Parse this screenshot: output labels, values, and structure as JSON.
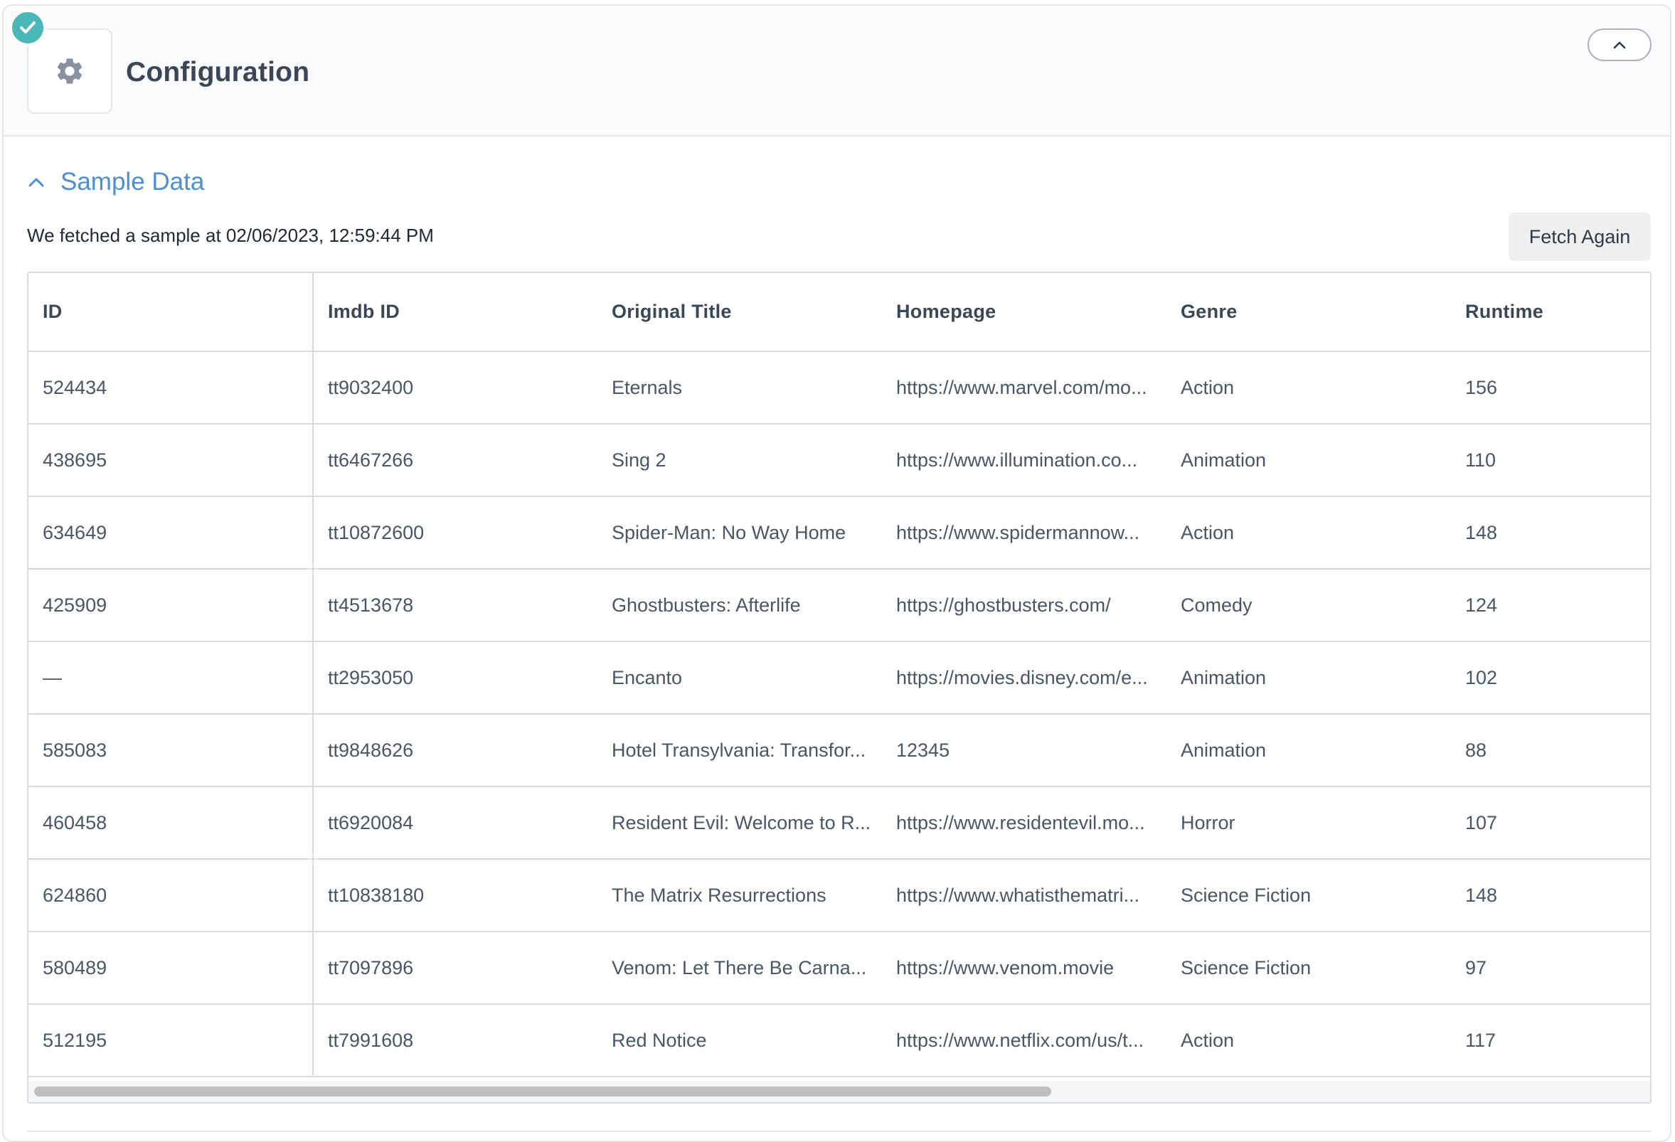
{
  "header": {
    "title": "Configuration",
    "status_icon": "check-circle-icon",
    "settings_icon": "gear-icon",
    "collapse_icon": "chevron-up-icon"
  },
  "sample_section": {
    "title": "Sample Data",
    "toggle_icon": "chevron-up-icon",
    "fetch_info": "We fetched a sample at 02/06/2023, 12:59:44 PM",
    "fetch_button_label": "Fetch Again"
  },
  "table": {
    "columns": [
      "ID",
      "Imdb ID",
      "Original Title",
      "Homepage",
      "Genre",
      "Runtime"
    ],
    "rows": [
      [
        "524434",
        "tt9032400",
        "Eternals",
        "https://www.marvel.com/mo...",
        "Action",
        "156"
      ],
      [
        "438695",
        "tt6467266",
        "Sing 2",
        "https://www.illumination.co...",
        "Animation",
        "110"
      ],
      [
        "634649",
        "tt10872600",
        "Spider-Man: No Way Home",
        "https://www.spidermannow...",
        "Action",
        "148"
      ],
      [
        "425909",
        "tt4513678",
        "Ghostbusters: Afterlife",
        "https://ghostbusters.com/",
        "Comedy",
        "124"
      ],
      [
        "—",
        "tt2953050",
        "Encanto",
        "https://movies.disney.com/e...",
        "Animation",
        "102"
      ],
      [
        "585083",
        "tt9848626",
        "Hotel Transylvania: Transfor...",
        "12345",
        "Animation",
        "88"
      ],
      [
        "460458",
        "tt6920084",
        "Resident Evil: Welcome to R...",
        "https://www.residentevil.mo...",
        "Horror",
        "107"
      ],
      [
        "624860",
        "tt10838180",
        "The Matrix Resurrections",
        "https://www.whatisthematri...",
        "Science Fiction",
        "148"
      ],
      [
        "580489",
        "tt7097896",
        "Venom: Let There Be Carna...",
        "https://www.venom.movie",
        "Science Fiction",
        "97"
      ],
      [
        "512195",
        "tt7991608",
        "Red Notice",
        "https://www.netflix.com/us/t...",
        "Action",
        "117"
      ]
    ]
  },
  "colors": {
    "accent": "#4d8fcf",
    "success": "#4ab8b8",
    "border": "#d6dbe1",
    "text": "#3b4656"
  }
}
